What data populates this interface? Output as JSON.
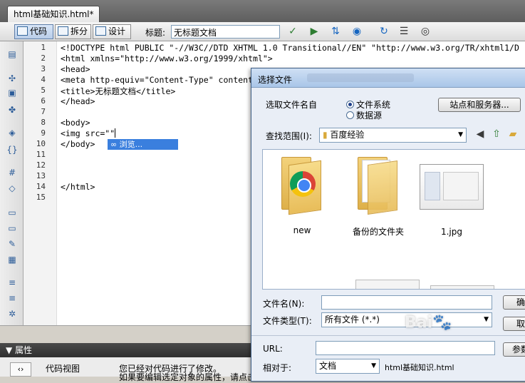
{
  "document_tab": "html基础知识.html*",
  "toolbar": {
    "code_label": "代码",
    "split_label": "拆分",
    "design_label": "设计",
    "title_label": "标题:",
    "title_value": "无标题文档"
  },
  "code": {
    "line_numbers": [
      "1",
      "2",
      "3",
      "4",
      "5",
      "6",
      "7",
      "8",
      "9",
      "10",
      "11",
      "12",
      "13",
      "14",
      "15"
    ],
    "lines": [
      "<!DOCTYPE html PUBLIC \"-//W3C//DTD XHTML 1.0 Transitional//EN\" \"http://www.w3.org/TR/xhtml1/D",
      "<html xmlns=\"http://www.w3.org/1999/xhtml\">",
      "<head>",
      "<meta http-equiv=\"Content-Type\" content",
      "<title>无标题文档</title>",
      "</head>",
      "",
      "<body>",
      "<img src=\"\"",
      "</body>",
      "",
      "",
      "",
      "</html>",
      ""
    ],
    "hint_label": "浏览..."
  },
  "properties": {
    "header": "属性",
    "view_label": "代码视图",
    "message_line1": "您已经对代码进行了修改。",
    "message_line2": "如果要编辑选定对象的属性，请点击"
  },
  "dialog": {
    "title": "选择文件",
    "select_from_label": "选取文件名自",
    "radio_filesystem": "文件系统",
    "radio_datasource": "数据源",
    "sites_button": "站点和服务器...",
    "lookin_label": "查找范围(I):",
    "lookin_value": "百度经验",
    "files": [
      {
        "name": "new"
      },
      {
        "name": "备份的文件夹"
      },
      {
        "name": "1.jpg"
      }
    ],
    "filename_label": "文件名(N):",
    "filetype_label": "文件类型(T):",
    "filetype_value": "所有文件 (*.*)",
    "confirm_button": "确",
    "cancel_button": "取",
    "url_label": "URL:",
    "relative_label": "相对于:",
    "relative_value": "文档",
    "relative_file": "html基础知识.html",
    "params_button": "参数"
  },
  "watermark": "Bai"
}
